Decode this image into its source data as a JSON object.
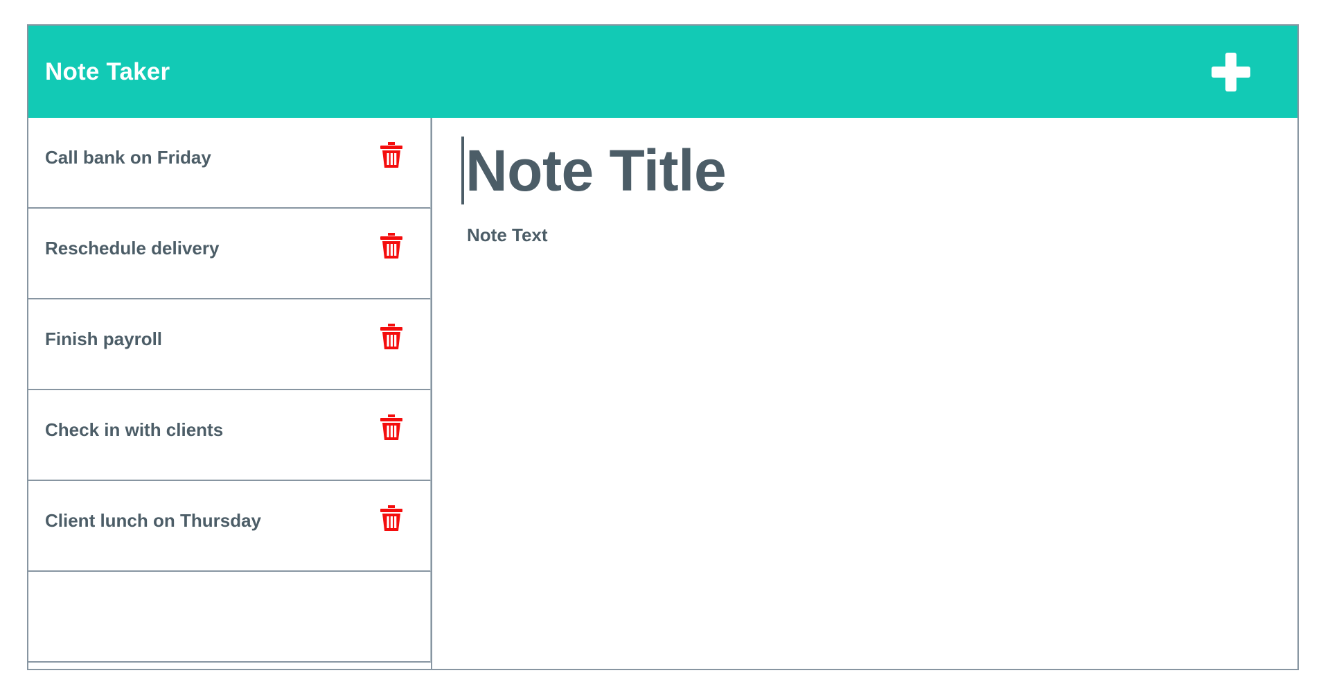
{
  "header": {
    "title": "Note Taker",
    "add_button_label": "+",
    "add_button_icon": "plus-icon",
    "background_color": "#12cab5",
    "title_color": "#ffffff"
  },
  "sidebar": {
    "delete_icon": "trash-icon",
    "delete_icon_color": "#f40d0d",
    "items": [
      {
        "label": "Call bank on Friday",
        "has_delete": true
      },
      {
        "label": "Reschedule delivery",
        "has_delete": true
      },
      {
        "label": "Finish payroll",
        "has_delete": true
      },
      {
        "label": "Check in with clients",
        "has_delete": true
      },
      {
        "label": "Client lunch on Thursday",
        "has_delete": true
      },
      {
        "label": "",
        "has_delete": false
      }
    ]
  },
  "editor": {
    "title_value": "",
    "title_placeholder": "Note Title",
    "text_value": "",
    "text_placeholder": "Note Text",
    "caret_visible": true,
    "text_color": "#4c5d67"
  },
  "theme": {
    "accent": "#12cab5",
    "border": "#8795a1",
    "text": "#4c5d67",
    "danger": "#f40d0d",
    "background": "#ffffff"
  }
}
